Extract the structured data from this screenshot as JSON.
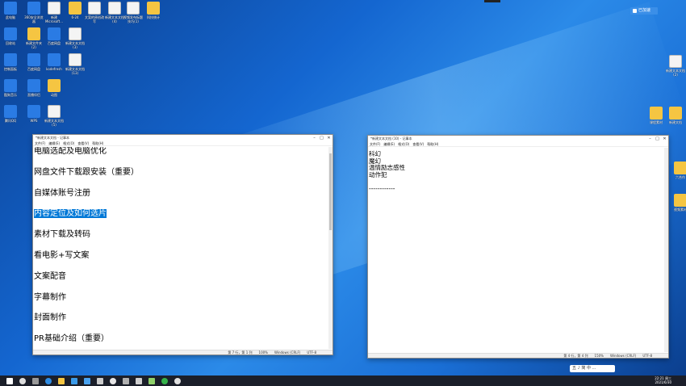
{
  "badge": {
    "label": "已加速"
  },
  "desktop_icons_left": [
    {
      "label": "此电脑",
      "kind": "app"
    },
    {
      "label": "360安全浏览器",
      "kind": "app"
    },
    {
      "label": "新建 Microsoft...",
      "kind": "doc"
    },
    {
      "label": "6-24",
      "kind": "folder"
    },
    {
      "label": "文案的原创改写",
      "kind": "doc"
    },
    {
      "label": "新建文本文档 (4)",
      "kind": "doc"
    },
    {
      "label": "视频发布标题技巧(1)",
      "kind": "doc"
    },
    {
      "label": "科技统计",
      "kind": "folder"
    },
    {
      "label": "回收站",
      "kind": "app"
    },
    {
      "label": "新建文件夹 (2)",
      "kind": "folder"
    },
    {
      "label": "百度网盘",
      "kind": "app"
    },
    {
      "label": "新建文本文档 (3)",
      "kind": "doc"
    },
    {
      "label": "控制面板",
      "kind": "app"
    },
    {
      "label": "百度网盘",
      "kind": "app"
    },
    {
      "label": "kodefresh",
      "kind": "app"
    },
    {
      "label": "新建文本文档 (13)",
      "kind": "doc"
    },
    {
      "label": "酷狗音乐",
      "kind": "app"
    },
    {
      "label": "直播伴侣",
      "kind": "app"
    },
    {
      "label": "动图",
      "kind": "folder"
    },
    {
      "label": "腾讯QQ",
      "kind": "app"
    },
    {
      "label": "WPS",
      "kind": "app"
    },
    {
      "label": "新建文本文档 (5)",
      "kind": "doc"
    }
  ],
  "desktop_icons_right": [
    {
      "label": "新建文本文档 (2)"
    },
    {
      "label": "课程素材"
    },
    {
      "label": "新建文档"
    },
    {
      "label": "六合作"
    },
    {
      "label": "视频素材"
    }
  ],
  "notepad_left": {
    "title": "*新建文本文档 - 记事本",
    "menu": [
      "文件(F)",
      "编辑(E)",
      "格式(O)",
      "查看(V)",
      "帮助(H)"
    ],
    "lines": [
      {
        "text": "电脑选配及电脑优化",
        "selected": false
      },
      {
        "text": "网盘文件下载跟安装（重要）",
        "selected": false
      },
      {
        "text": "自媒体账号注册",
        "selected": false
      },
      {
        "text": "内容定位及如何选片",
        "selected": true
      },
      {
        "text": "素材下载及转码",
        "selected": false
      },
      {
        "text": "看电影+写文案",
        "selected": false
      },
      {
        "text": "文案配音",
        "selected": false
      },
      {
        "text": "字幕制作",
        "selected": false
      },
      {
        "text": "封面制作",
        "selected": false
      },
      {
        "text": "PR基础介绍（重要）",
        "selected": false
      }
    ],
    "status": [
      "第 7 行，第 1 列",
      "100%",
      "Windows (CRLF)",
      "UTF-8"
    ]
  },
  "notepad_right": {
    "title": "*新建文本文档 (10) - 记事本",
    "menu": [
      "文件(F)",
      "编辑(E)",
      "格式(O)",
      "查看(V)",
      "帮助(H)"
    ],
    "lines": [
      "科幻",
      "魔幻",
      "温情励志感性",
      "动作犯",
      "",
      "------------"
    ],
    "status": [
      "第 4 行，第 4 列",
      "150%",
      "Windows (CRLF)",
      "UTF-8"
    ]
  },
  "ime": {
    "label": "五 ♪ 简 中 ..."
  },
  "tray": {
    "time": "22:21 周三",
    "date": "2021/6/30"
  },
  "colors": {
    "selection": "#0078d7",
    "taskbar": "#1b1f2a",
    "desktop": "#1466d0"
  }
}
